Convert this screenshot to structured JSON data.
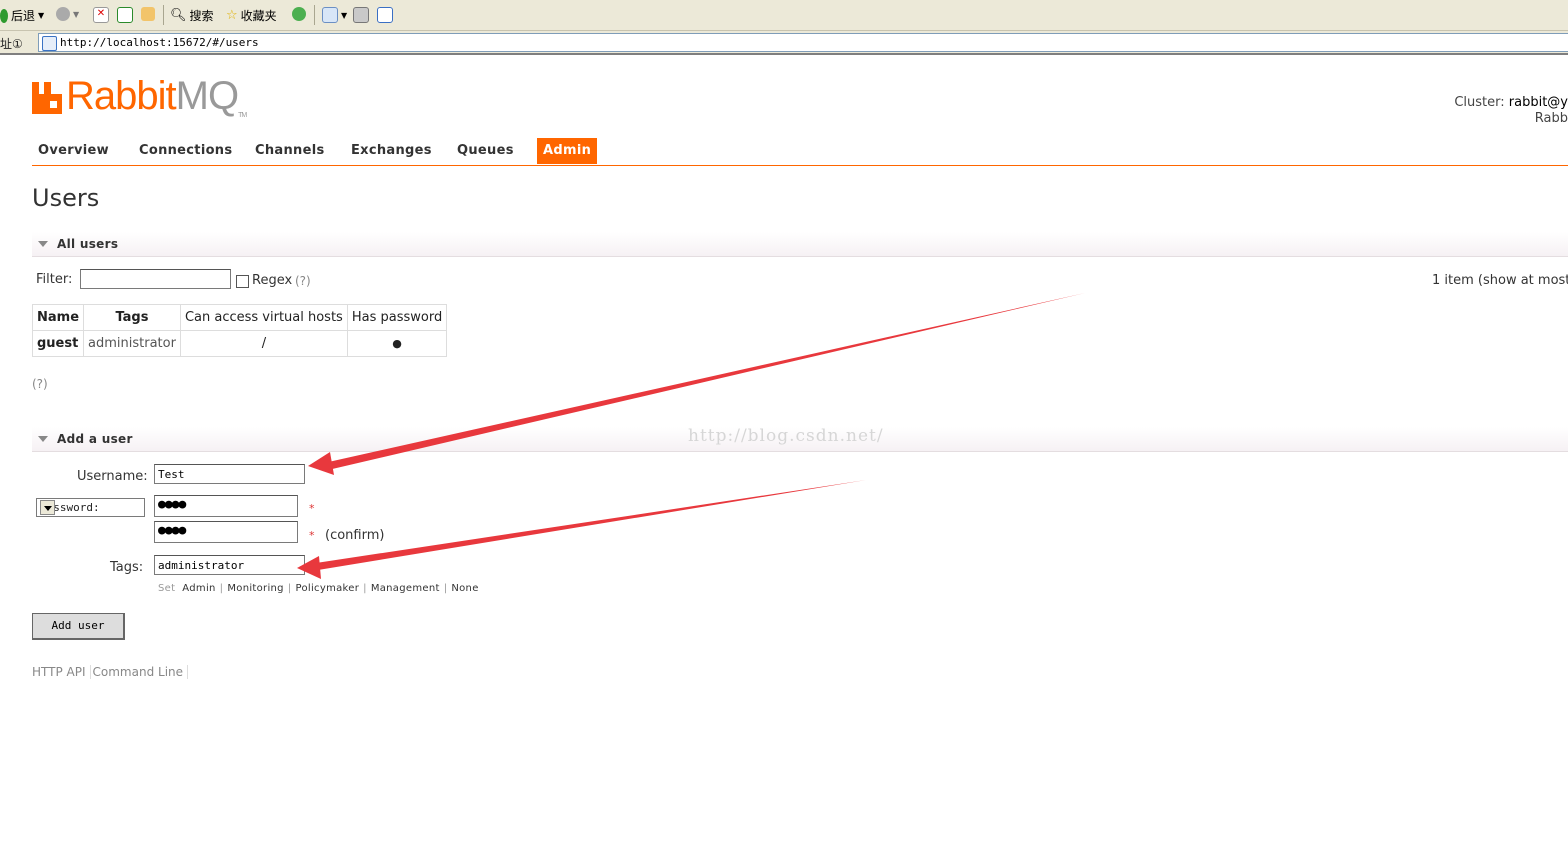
{
  "browser": {
    "toolbar": {
      "back_label": "后退",
      "search_label": "搜索",
      "favorites_label": "收藏夹"
    },
    "address": {
      "label": "址①",
      "url": "http://localhost:15672/#/users"
    }
  },
  "logo": {
    "part1": "Rabbit",
    "part2": "MQ",
    "tm": "TM"
  },
  "cluster": {
    "label": "Cluster:",
    "value": "rabbit@y",
    "line2": "Rabb"
  },
  "nav": {
    "items": [
      "Overview",
      "Connections",
      "Channels",
      "Exchanges",
      "Queues",
      "Admin"
    ],
    "active": "Admin"
  },
  "page_title": "Users",
  "all_users": {
    "section_label": "All users",
    "filter_label": "Filter:",
    "filter_value": "",
    "regex_label": "Regex",
    "regex_help": "(?)",
    "item_count": "1 item (show at most",
    "columns": [
      "Name",
      "Tags",
      "Can access virtual hosts",
      "Has password"
    ],
    "rows": [
      {
        "name": "guest",
        "tags": "administrator",
        "vhosts": "/",
        "has_password": "●"
      }
    ],
    "help": "(?)"
  },
  "add_user": {
    "section_label": "Add a user",
    "username_label": "Username:",
    "username_value": "Test",
    "password_mode": "Password:",
    "password_value": "●●●●",
    "confirm_value": "●●●●",
    "confirm_label": "(confirm)",
    "required_mark": "*",
    "tags_label": "Tags:",
    "tags_value": "administrator",
    "set_label": "Set",
    "tag_options": [
      "Admin",
      "Monitoring",
      "Policymaker",
      "Management",
      "None"
    ],
    "submit_label": "Add user"
  },
  "footer": {
    "links": [
      "HTTP API",
      "Command Line"
    ]
  },
  "watermark": "http://blog.csdn.net/",
  "colors": {
    "accent": "#ff6600",
    "arrow": "#e8383d"
  }
}
